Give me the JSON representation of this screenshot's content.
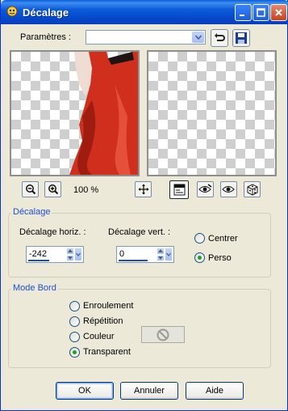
{
  "window": {
    "title": "Décalage"
  },
  "presets": {
    "label": "Paramètres :",
    "value": ""
  },
  "zoom": {
    "level": "100 %"
  },
  "offset_group": {
    "legend": "Décalage",
    "horizontal": {
      "label": "Décalage horiz. :",
      "value": "-242"
    },
    "vertical": {
      "label": "Décalage vert. :",
      "value": "0"
    },
    "radios": [
      {
        "label": "Centrer",
        "checked": false
      },
      {
        "label": "Perso",
        "checked": true
      }
    ]
  },
  "edge_group": {
    "legend": "Mode Bord",
    "radios": [
      {
        "label": "Enroulement",
        "checked": false
      },
      {
        "label": "Répétition",
        "checked": false
      },
      {
        "label": "Couleur",
        "checked": false
      },
      {
        "label": "Transparent",
        "checked": true
      }
    ]
  },
  "buttons": {
    "ok": "OK",
    "cancel": "Annuler",
    "help": "Aide"
  },
  "colors": {
    "title_bar": "#0546c9",
    "dialog_bg": "#ece9d8",
    "accent": "#1c4fd1",
    "dress": "#d3321e"
  }
}
